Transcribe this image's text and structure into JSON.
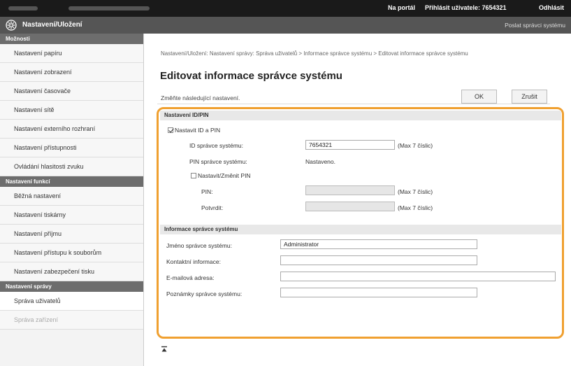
{
  "topbar": {
    "portal_link": "Na portál",
    "login_user": "Přihlásit uživatele: 7654321",
    "logout_link": "Odhlásit"
  },
  "titlebar": {
    "title": "Nastavení/Uložení",
    "send_link": "Poslat správci systému"
  },
  "sidebar": {
    "sections": [
      {
        "label": "Možnosti",
        "items": [
          "Nastavení papíru",
          "Nastavení zobrazení",
          "Nastavení časovače",
          "Nastavení sítě",
          "Nastavení externího rozhraní",
          "Nastavení přístupnosti",
          "Ovládání hlasitosti zvuku"
        ]
      },
      {
        "label": "Nastavení funkcí",
        "items": [
          "Běžná nastavení",
          "Nastavení tiskárny",
          "Nastavení příjmu",
          "Nastavení přístupu k souborům",
          "Nastavení zabezpečení tisku"
        ]
      },
      {
        "label": "Nastavení správy",
        "items": [
          "Správa uživatelů",
          "Správa zařízení"
        ]
      }
    ]
  },
  "main": {
    "breadcrumb": "Nastavení/Uložení: Nastavení správy: Správa uživatelů > Informace správce systému > Editovat informace správce systému",
    "page_title": "Editovat informace správce systému",
    "instruction": "Změňte následující nastavení.",
    "ok_label": "OK",
    "cancel_label": "Zrušit",
    "id_pin_section": {
      "header": "Nastavení ID/PIN",
      "set_id_pin_label": "Nastavit ID a PIN",
      "set_id_pin_checked": true,
      "admin_id_label": "ID správce systému:",
      "admin_id_value": "7654321",
      "admin_id_hint": "(Max 7 číslic)",
      "admin_pin_label": "PIN správce systému:",
      "admin_pin_status": "Nastaveno.",
      "change_pin_label": "Nastavit/Změnit PIN",
      "change_pin_checked": false,
      "pin_label": "PIN:",
      "pin_hint": "(Max 7 číslic)",
      "confirm_label": "Potvrdit:",
      "confirm_hint": "(Max 7 číslic)"
    },
    "admin_info_section": {
      "header": "Informace správce systému",
      "name_label": "Jméno správce systému:",
      "name_value": "Administrator",
      "contact_label": "Kontaktní informace:",
      "contact_value": "",
      "email_label": "E-mailová adresa:",
      "email_value": "",
      "comment_label": "Poznámky správce systému:",
      "comment_value": ""
    }
  },
  "colors": {
    "highlight": "#f0a030",
    "topbar": "#1a1a1a",
    "titlebar": "#555555"
  }
}
